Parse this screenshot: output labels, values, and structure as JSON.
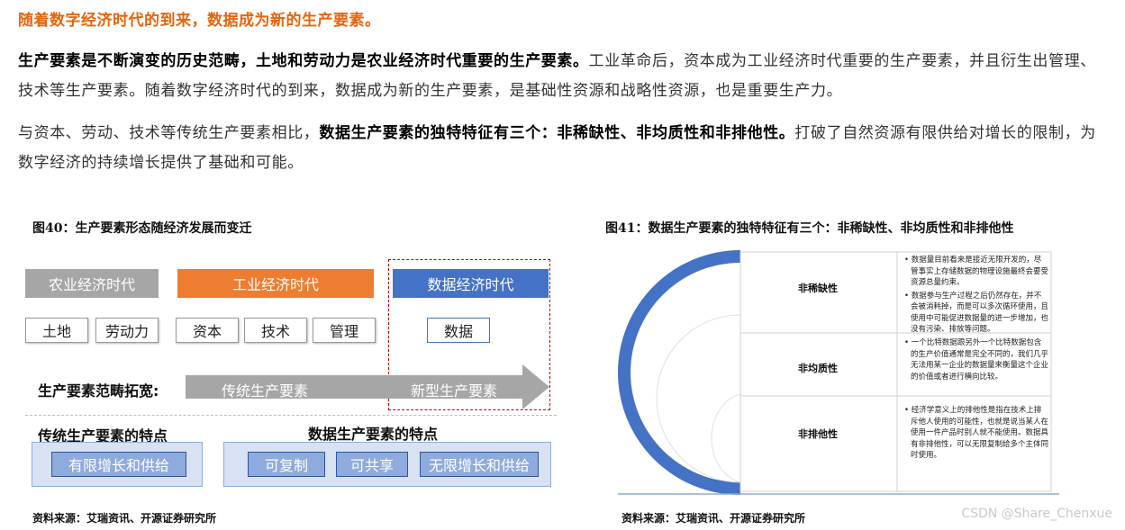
{
  "heading": "随着数字经济时代的到来，数据成为新的生产要素。",
  "paragraph1": {
    "bold": "生产要素是不断演变的历史范畴，土地和劳动力是农业经济时代重要的生产要素。",
    "normal": "工业革命后，资本成为工业经济时代重要的生产要素，并且衍生出管理、技术等生产要素。随着数字经济时代的到来，数据成为新的生产要素，是基础性资源和战略性资源，也是重要生产力。"
  },
  "paragraph2": {
    "pre": "与资本、劳动、技术等传统生产要素相比，",
    "bold": "数据生产要素的独特特征有三个：非稀缺性、非均质性和非排他性。",
    "post": "打破了自然资源有限供给对增长的限制，为数字经济的持续增长提供了基础和可能。"
  },
  "figure40": {
    "title": "图40：生产要素形态随经济发展而变迁",
    "eras": [
      "农业经济时代",
      "工业经济时代",
      "数据经济时代"
    ],
    "agri_elements": [
      "土地",
      "劳动力"
    ],
    "ind_elements": [
      "资本",
      "技术",
      "管理"
    ],
    "dig_elements": [
      "数据"
    ],
    "scope_label": "生产要素范畴拓宽:",
    "arrow_left": "传统生产要素",
    "arrow_right": "新型生产要素",
    "trad_feat_title": "传统生产要素的特点",
    "data_feat_title": "数据生产要素的特点",
    "trad_feats": [
      "有限增长和供给"
    ],
    "data_feats": [
      "可复制",
      "可共享",
      "无限增长和供给"
    ],
    "source": "资料来源：艾瑞资讯、开源证券研究所",
    "colors": {
      "agri": "#a6a6a6",
      "industrial": "#ed7d31",
      "digital": "#4472c4",
      "dashed": "#c00000"
    }
  },
  "figure41": {
    "title": "图41：数据生产要素的独特特征有三个：非稀缺性、非均质性和非排他性",
    "rows": [
      {
        "label": "非稀缺性",
        "bullets": [
          "数据量目前看来是接近无限开发的，尽管事实上存储数据的物理设施最终会要受资源总量约束。",
          "数据参与生产过程之后仍然存在，并不会被消耗掉，而是可以多次循环使用，且使用中可能促进数据量的进一步增加，也没有污染、排放等问题。"
        ]
      },
      {
        "label": "非均质性",
        "bullets": [
          "一个比特数据跟另外一个比特数据包含的生产价值通常是完全不同的，我们几乎无法用某一企业的数据量来衡量这个企业的价值或者进行横向比较。"
        ]
      },
      {
        "label": "非排他性",
        "bullets": [
          "经济学意义上的排他性是指在技术上排斥他人使用的可能性，也就是说当某人在使用一件产品时别人就不能使用。数据具有非排他性，可以无限复制给多个主体同时使用。"
        ]
      }
    ],
    "source": "资料来源：艾瑞资讯、开源证券研究所",
    "colors": {
      "semicircle": "#4472c4"
    }
  },
  "watermark": "CSDN @Share_Chenxue"
}
